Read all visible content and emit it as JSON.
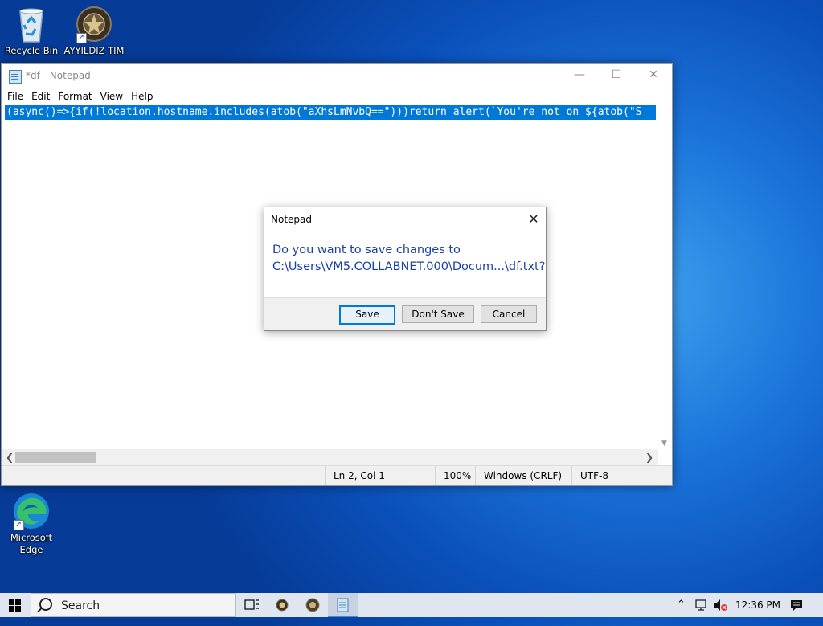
{
  "desktop": {
    "icons": [
      {
        "label": "Recycle Bin",
        "icon": "recycle-bin-icon"
      },
      {
        "label": "AYYILDIZ TIM",
        "icon": "emblem-icon"
      },
      {
        "label": "Microsoft Edge",
        "icon": "edge-icon"
      }
    ]
  },
  "notepad": {
    "title": "*df - Notepad",
    "menu": [
      "File",
      "Edit",
      "Format",
      "View",
      "Help"
    ],
    "content": "(async()=>{if(!location.hostname.includes(atob(\"aXhsLmNvbQ==\")))return alert(`You're not on ${atob(\"S",
    "status": {
      "position": "Ln 2, Col 1",
      "zoom": "100%",
      "line_ending": "Windows (CRLF)",
      "encoding": "UTF-8"
    },
    "horizontal_scroll_fraction": 0.0
  },
  "dialog": {
    "title": "Notepad",
    "message_line1": "Do you want to save changes to",
    "message_line2": "C:\\Users\\VM5.COLLABNET.000\\Docum...\\df.txt?",
    "buttons": {
      "save": "Save",
      "dont_save": "Don't Save",
      "cancel": "Cancel"
    }
  },
  "taskbar": {
    "search_placeholder": "Search",
    "clock": "12:36 PM"
  },
  "colors": {
    "selection": "#0078d7",
    "dialog_text": "#1a3fa6",
    "desktop": "#0a4fb8"
  }
}
